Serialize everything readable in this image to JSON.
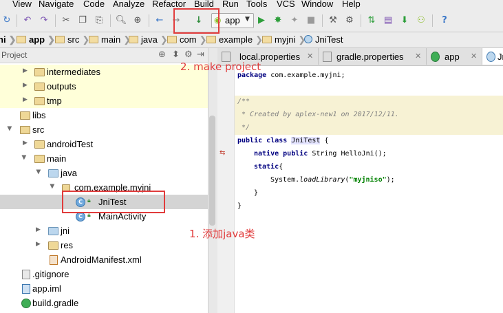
{
  "menu": [
    "t",
    "View",
    "Navigate",
    "Code",
    "Analyze",
    "Refactor",
    "Build",
    "Run",
    "Tools",
    "VCS",
    "Window",
    "Help"
  ],
  "toolbar": {
    "run_config": "app",
    "make_icon": "make-project-icon"
  },
  "breadcrumb": [
    "ni",
    "app",
    "src",
    "main",
    "java",
    "com",
    "example",
    "myjni",
    "JniTest"
  ],
  "project_panel": {
    "title": "Project"
  },
  "tree": [
    {
      "label": "intermediates",
      "type": "folder",
      "highlight": true
    },
    {
      "label": "outputs",
      "type": "folder",
      "highlight": true
    },
    {
      "label": "tmp",
      "type": "folder",
      "highlight": true
    },
    {
      "label": "libs",
      "type": "folder"
    },
    {
      "label": "src",
      "type": "folder"
    },
    {
      "label": "androidTest",
      "type": "folder"
    },
    {
      "label": "main",
      "type": "folder"
    },
    {
      "label": "java",
      "type": "folder"
    },
    {
      "label": "com.example.myjni",
      "type": "package"
    },
    {
      "label": "JniTest",
      "type": "class",
      "selected": true
    },
    {
      "label": "MainActivity",
      "type": "class"
    },
    {
      "label": "jni",
      "type": "folder"
    },
    {
      "label": "res",
      "type": "folder"
    },
    {
      "label": "AndroidManifest.xml",
      "type": "file"
    },
    {
      "label": ".gitignore",
      "type": "file"
    },
    {
      "label": "app.iml",
      "type": "file"
    },
    {
      "label": "build.gradle",
      "type": "file"
    }
  ],
  "tabs": [
    {
      "label": "local.properties"
    },
    {
      "label": "gradle.properties"
    },
    {
      "label": "app"
    },
    {
      "label": "Jni"
    }
  ],
  "code": {
    "package_kw": "package",
    "package_name": "com.example.myjni;",
    "doc_open": "/**",
    "doc_body": " * Created by aplex-new1 on 2017/12/11.",
    "doc_close": " */",
    "kw_public": "public",
    "kw_class": "class",
    "class_name": "JniTest",
    "class_brace": " {",
    "kw_native": "native",
    "method_decl": "String HelloJni();",
    "kw_static": "static",
    "static_brace": "{",
    "load_prefix": "System.",
    "load_method": "loadLibrary",
    "load_arg": "\"myjniso\"",
    "load_suffix": ");",
    "close_inner": "}",
    "close_outer": "}"
  },
  "annotations": {
    "make_project": "2. make project",
    "add_class": "1. 添加java类"
  },
  "colors": {
    "annotation": "#e13c3c",
    "keyword": "#000080",
    "string": "#008000",
    "comment": "#808080"
  }
}
